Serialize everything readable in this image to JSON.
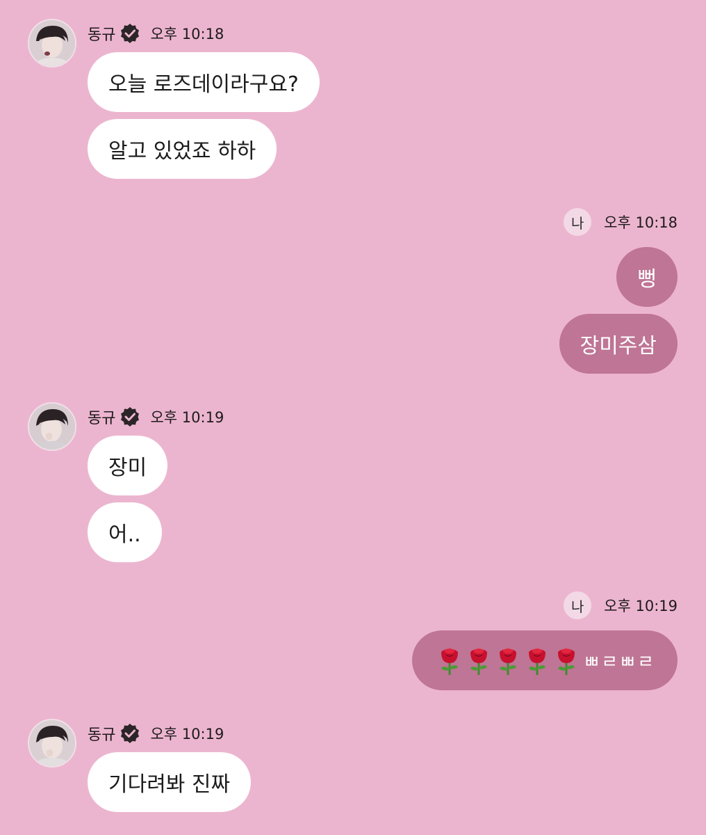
{
  "colors": {
    "background": "#ecb5cf",
    "incoming_bubble": "#ffffff",
    "outgoing_bubble": "#bf7595",
    "me_badge": "#f3d9e6"
  },
  "contact": {
    "name": "동규",
    "verified_icon": "verified-badge-icon"
  },
  "me_label": "나",
  "conversation": [
    {
      "type": "incoming",
      "time": "오후 10:18",
      "messages": [
        "오늘 로즈데이라구요?",
        "알고 있었죠 하하"
      ]
    },
    {
      "type": "outgoing",
      "time": "오후 10:18",
      "messages": [
        "뻥",
        "장미주삼"
      ]
    },
    {
      "type": "incoming",
      "time": "오후 10:19",
      "messages": [
        "장미",
        "어.."
      ]
    },
    {
      "type": "outgoing",
      "time": "오후 10:19",
      "messages": [
        {
          "emoji": "rose-emoji",
          "emoji_count": 5,
          "text": "ㅃㄹㅃㄹ"
        }
      ]
    },
    {
      "type": "incoming",
      "time": "오후 10:19",
      "messages": [
        "기다려봐 진짜"
      ]
    }
  ]
}
